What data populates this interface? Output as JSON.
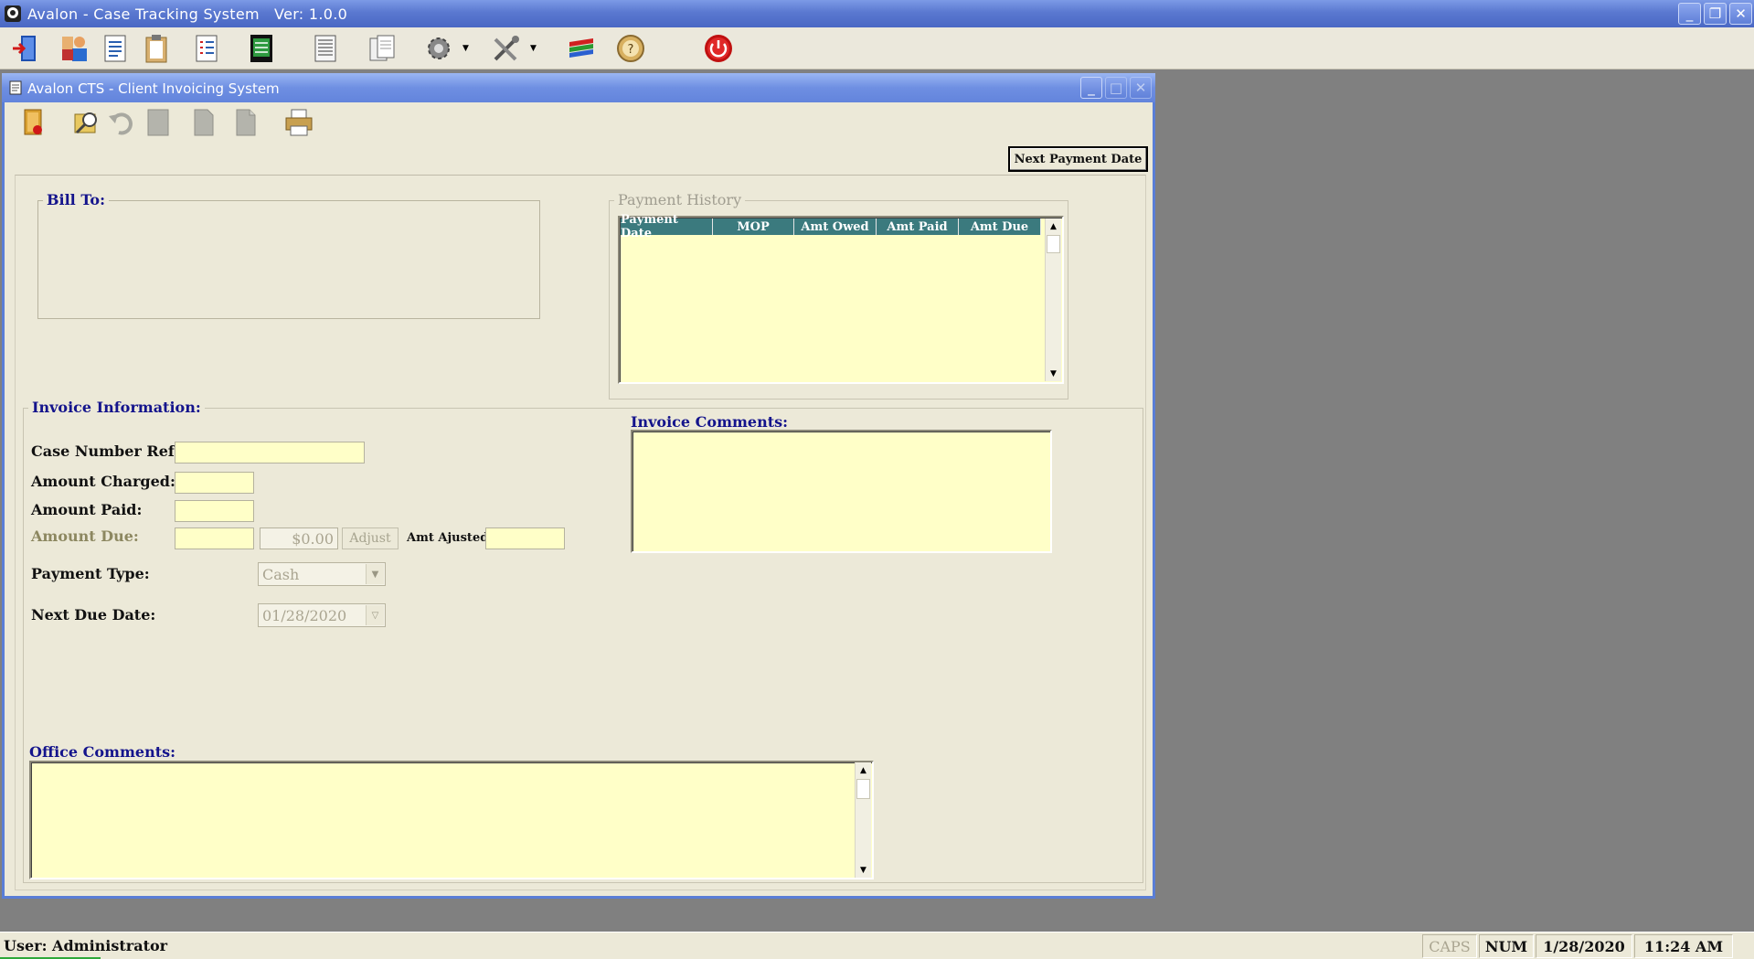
{
  "app": {
    "title": "Avalon - Case Tracking System   Ver: 1.0.0",
    "window_controls": {
      "minimize": "_",
      "restore": "❐",
      "close": "✕"
    }
  },
  "main_toolbar": {
    "icons": [
      "exit-door-icon",
      "users-icon",
      "document-icon",
      "clipboard-icon",
      "checklist-icon",
      "ledger-icon",
      "report-icon",
      "pages-icon",
      "gear-icon",
      "tools-icon",
      "color-books-icon",
      "help-icon",
      "power-icon"
    ]
  },
  "child_window": {
    "title": "Avalon CTS - Client Invoicing System",
    "toolbar_icons": [
      "close-form-icon",
      "search-icon",
      "undo-icon",
      "blank-page-icon",
      "new-page-icon",
      "copy-page-icon",
      "print-icon"
    ],
    "next_payment_button": "Next Payment Date"
  },
  "bill_to": {
    "legend": "Bill To:"
  },
  "payment_history": {
    "legend": "Payment History",
    "columns": [
      "Payment Date",
      "MOP",
      "Amt Owed",
      "Amt Paid",
      "Amt Due"
    ],
    "rows": []
  },
  "invoice_info": {
    "legend": "Invoice Information:",
    "case_number_label": "Case Number Ref:",
    "case_number_value": "",
    "amount_charged_label": "Amount Charged:",
    "amount_charged_value": "",
    "amount_paid_label": "Amount Paid:",
    "amount_paid_value": "",
    "amount_due_label": "Amount Due:",
    "amount_due_value": "",
    "amount_due_display": "$0.00",
    "adjust_button": "Adjust",
    "amt_adjusted_label": "Amt Ajusted:",
    "amt_adjusted_value": "",
    "payment_type_label": "Payment Type:",
    "payment_type_value": "Cash",
    "next_due_date_label": "Next Due Date:",
    "next_due_date_value": "01/28/2020"
  },
  "invoice_comments": {
    "label": "Invoice Comments:",
    "value": ""
  },
  "office_comments": {
    "label": "Office Comments:",
    "value": ""
  },
  "status_bar": {
    "user": "User: Administrator",
    "caps": "CAPS",
    "num": "NUM",
    "date": "1/28/2020",
    "time": "11:24 AM"
  }
}
